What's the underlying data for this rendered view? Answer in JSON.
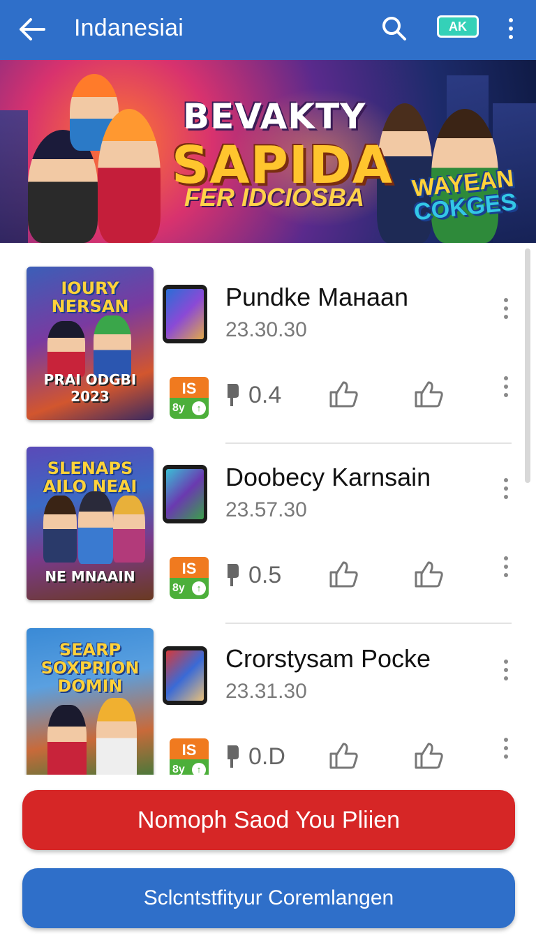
{
  "appbar": {
    "title": "Indanesiai",
    "account_badge": "AK",
    "icons": [
      "back-arrow-icon",
      "search-icon",
      "more-vert-icon"
    ],
    "color": "#2f6fc9"
  },
  "banner": {
    "line1": "BEVAKTY",
    "line2": "SAPIDA",
    "line3": "FER IDCIOSBA",
    "side_line1": "WAYEAN",
    "side_line2": "COKGES"
  },
  "items": [
    {
      "cover_title": "IOURY NERSAN",
      "cover_sub": "PRAI ODGBI 2023",
      "name": "Pundke Mанаan",
      "date": "23.30.30",
      "badge_top": "IS",
      "badge_bottom": "8y",
      "count": "0.4"
    },
    {
      "cover_title": "SLENAPS AILO NEAI",
      "cover_sub": "NE MNAAIN",
      "name": "Doobecy Karnsain",
      "date": "23.57.30",
      "badge_top": "IS",
      "badge_bottom": "8y",
      "count": "0.5"
    },
    {
      "cover_title": "SEARP SOXPRION DOMIN",
      "cover_sub": "",
      "name": "Crorstysam Pocke",
      "date": "23.31.30",
      "badge_top": "IS",
      "badge_bottom": "8y",
      "count": "0.D"
    }
  ],
  "buttons": {
    "primary": "Nomoph Saod You Pliien",
    "secondary": "Sclcntstfityur Coremlangen"
  },
  "colors": {
    "primary_red": "#d62626",
    "brand_blue": "#2f6fc9",
    "badge_orange": "#f07a1f",
    "badge_green": "#4caf3a"
  }
}
